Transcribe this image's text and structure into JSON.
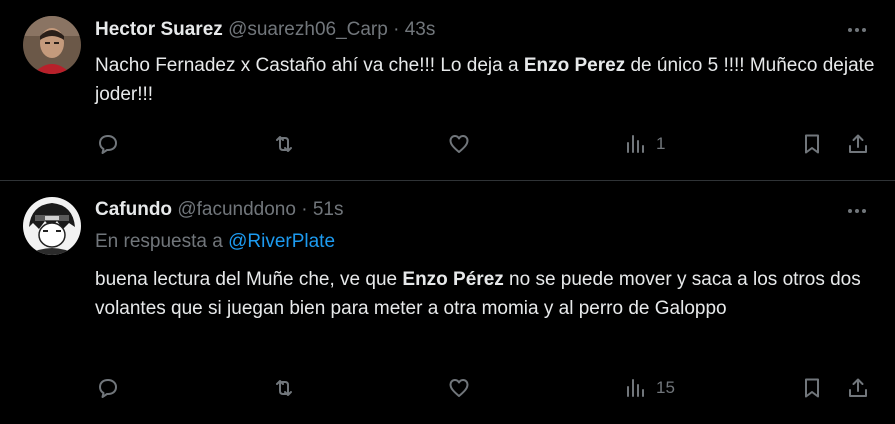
{
  "tweets": [
    {
      "name": "Hector Suarez",
      "handle": "@suarezh06_Carp",
      "separator": "·",
      "time": "43s",
      "text_parts": [
        "Nacho Fernadez  x Castaño  ahí va che!!! Lo deja a ",
        "Enzo Perez",
        " de único 5 !!!! Muñeco dejate joder!!!"
      ],
      "views": "1"
    },
    {
      "name": "Cafundo",
      "handle": "@facunddono",
      "separator": "·",
      "time": "51s",
      "reply_prefix": "En respuesta a ",
      "reply_mention": "@RiverPlate",
      "text_parts": [
        "buena lectura del Muñe che, ve que ",
        "Enzo Pérez",
        " no se puede mover y saca a los otros dos volantes que si juegan bien para meter a otra momia y al perro de Galoppo"
      ],
      "views": "15"
    }
  ],
  "icons": {
    "reply": "reply-icon",
    "retweet": "retweet-icon",
    "like": "heart-icon",
    "views": "views-icon",
    "bookmark": "bookmark-icon",
    "share": "share-icon",
    "more": "more-icon"
  },
  "colors": {
    "background": "#000000",
    "text": "#e7e9ea",
    "secondary": "#71767b",
    "link": "#1d9bf0",
    "divider": "#2f3336"
  }
}
